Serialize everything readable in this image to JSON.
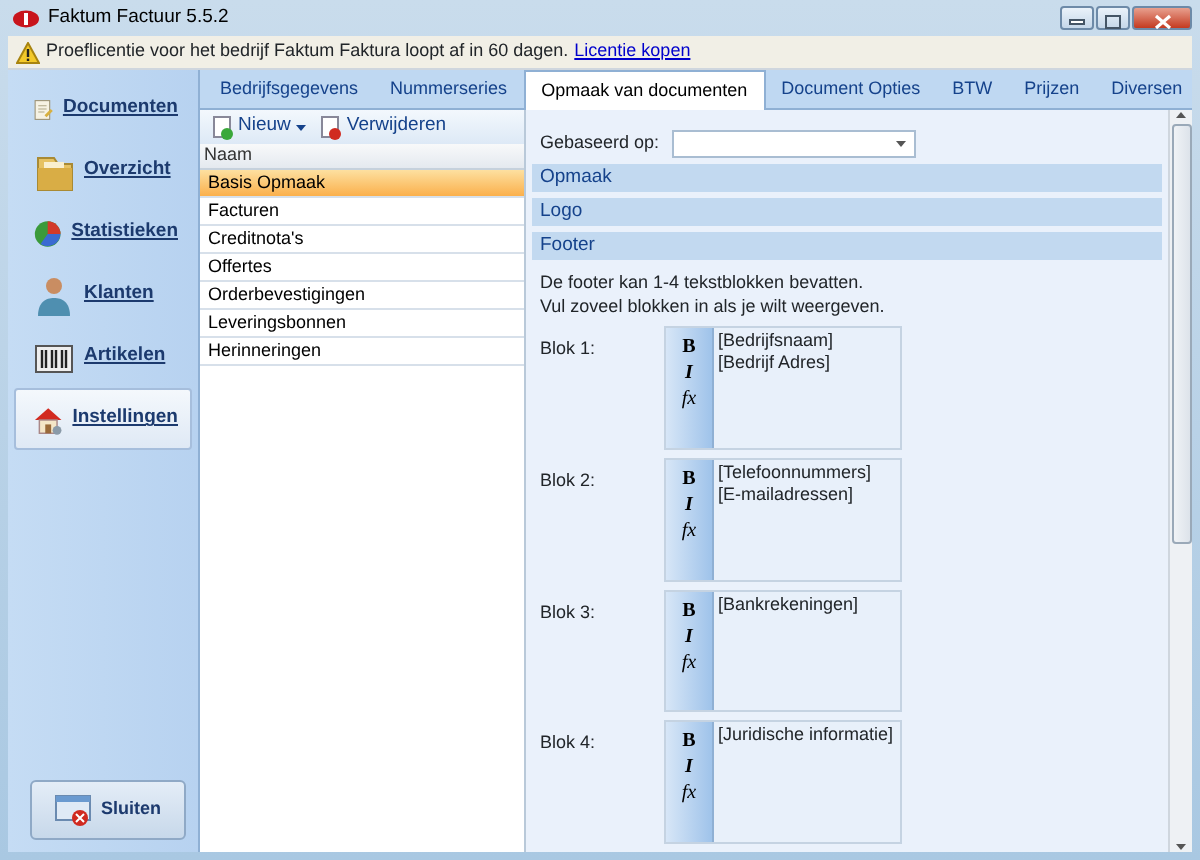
{
  "window": {
    "title": "Faktum Factuur 5.5.2"
  },
  "notice": {
    "text": "Proeflicentie voor het bedrijf Faktum Faktura loopt af in 60 dagen.",
    "link": "Licentie kopen"
  },
  "sidebar": {
    "items": [
      {
        "label": "Documenten",
        "selected": false
      },
      {
        "label": "Overzicht",
        "selected": false
      },
      {
        "label": "Statistieken",
        "selected": false
      },
      {
        "label": "Klanten",
        "selected": false
      },
      {
        "label": "Artikelen",
        "selected": false
      },
      {
        "label": "Instellingen",
        "selected": true
      }
    ],
    "close_button": "Sluiten"
  },
  "tabs": [
    {
      "label": "Bedrijfsgegevens",
      "selected": false
    },
    {
      "label": "Nummerseries",
      "selected": false
    },
    {
      "label": "Opmaak van documenten",
      "selected": true
    },
    {
      "label": "Document Opties",
      "selected": false
    },
    {
      "label": "BTW",
      "selected": false
    },
    {
      "label": "Prijzen",
      "selected": false
    },
    {
      "label": "Diversen",
      "selected": false
    }
  ],
  "toolbar": [
    {
      "label": "Nieuw",
      "kind": "add",
      "dropdown": true
    },
    {
      "label": "Verwijderen",
      "kind": "delete",
      "dropdown": false
    }
  ],
  "list": {
    "column": "Naam",
    "rows": [
      {
        "name": "Basis Opmaak",
        "selected": true
      },
      {
        "name": "Facturen",
        "selected": false
      },
      {
        "name": "Creditnota's",
        "selected": false
      },
      {
        "name": "Offertes",
        "selected": false
      },
      {
        "name": "Orderbevestigingen",
        "selected": false
      },
      {
        "name": "Leveringsbonnen",
        "selected": false
      },
      {
        "name": "Herinneringen",
        "selected": false
      }
    ]
  },
  "form": {
    "based_on_label": "Gebaseerd op:",
    "sections": [
      "Opmaak",
      "Logo",
      "Footer"
    ],
    "footer_description": [
      "De footer kan 1-4 tekstblokken bevatten.",
      "Vul zoveel blokken in als je wilt weergeven."
    ],
    "blocks": [
      {
        "label": "Blok 1:",
        "format_buttons": [
          "B",
          "I",
          "fx"
        ],
        "lines": [
          "[Bedrijfsnaam]",
          "[Bedrijf Adres]"
        ]
      },
      {
        "label": "Blok 2:",
        "format_buttons": [
          "B",
          "I",
          "fx"
        ],
        "lines": [
          "[Telefoonnummers]",
          "[E-mailadressen]"
        ]
      },
      {
        "label": "Blok 3:",
        "format_buttons": [
          "B",
          "I",
          "fx"
        ],
        "lines": [
          "[Bankrekeningen]"
        ]
      },
      {
        "label": "Blok 4:",
        "format_buttons": [
          "B",
          "I",
          "fx"
        ],
        "lines": [
          "[Juridische informatie]"
        ]
      }
    ]
  }
}
